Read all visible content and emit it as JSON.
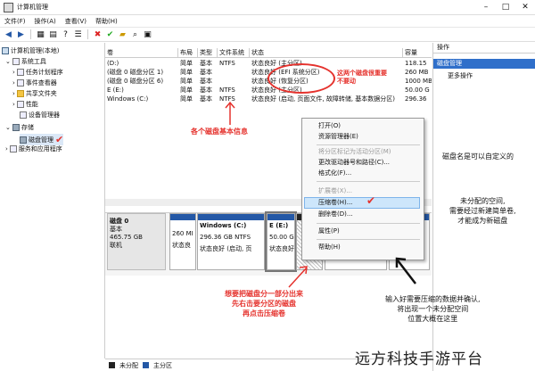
{
  "window": {
    "title": "计算机管理"
  },
  "menu": [
    "文件(F)",
    "操作(A)",
    "查看(V)",
    "帮助(H)"
  ],
  "tree": {
    "root": "计算机管理(本地)",
    "system_tools": "系统工具",
    "items": [
      "任务计划程序",
      "事件查看器",
      "共享文件夹",
      "性能",
      "设备管理器"
    ],
    "storage": "存储",
    "disk_mgmt": "磁盘管理",
    "services": "服务和应用程序"
  },
  "table": {
    "headers": [
      "卷",
      "布局",
      "类型",
      "文件系统",
      "状态",
      "容量"
    ],
    "rows": [
      [
        "(D:)",
        "简单",
        "基本",
        "NTFS",
        "状态良好 (主分区)",
        "118.15"
      ],
      [
        "(磁盘 0 磁盘分区 1)",
        "简单",
        "基本",
        "",
        "状态良好 (EFI 系统分区)",
        "260 MB"
      ],
      [
        "(磁盘 0 磁盘分区 6)",
        "简单",
        "基本",
        "",
        "状态良好 (恢复分区)",
        "1000 MB"
      ],
      [
        "E (E:)",
        "简单",
        "基本",
        "NTFS",
        "状态良好 (主分区)",
        "50.00 G"
      ],
      [
        "Windows (C:)",
        "简单",
        "基本",
        "NTFS",
        "状态良好 (启动, 页面文件, 故障转储, 基本数据分区)",
        "296.36"
      ]
    ]
  },
  "disk": {
    "label": "磁盘 0",
    "type": "基本",
    "size": "465.75 GB",
    "status": "联机",
    "segments": [
      {
        "l1": "260 MI",
        "l2": "状态良"
      },
      {
        "name": "Windows (C:)",
        "l1": "296.36 GB NTFS",
        "l2": "状态良好 (启动, 页"
      },
      {
        "name": "E (E:)",
        "l1": "50.00 G",
        "l2": "状态良好"
      },
      {
        "name": "",
        "l1": "",
        "l2": ""
      },
      {
        "name": "",
        "l1": "",
        "l2": ""
      },
      {
        "name": "",
        "l1": "",
        "l2": ""
      }
    ]
  },
  "legend": [
    "未分配",
    "主分区"
  ],
  "actions": {
    "header": "操作",
    "section": "磁盘管理",
    "more": "更多操作"
  },
  "context_menu": {
    "items": [
      {
        "label": "打开(O)",
        "disabled": false
      },
      {
        "label": "资源管理器(E)",
        "disabled": false
      },
      {
        "label": "将分区标记为活动分区(M)",
        "disabled": true
      },
      {
        "label": "更改驱动器号和路径(C)...",
        "disabled": false
      },
      {
        "label": "格式化(F)...",
        "disabled": false
      },
      {
        "label": "扩展卷(X)...",
        "disabled": true
      },
      {
        "label": "压缩卷(H)...",
        "disabled": false
      },
      {
        "label": "删除卷(D)...",
        "disabled": false
      },
      {
        "label": "属性(P)",
        "disabled": false
      },
      {
        "label": "帮助(H)",
        "disabled": false
      }
    ]
  },
  "annotations": {
    "oval_note": [
      "这两个磁盘很重要",
      "不要动"
    ],
    "info": "各个磁盘基本信息",
    "disk_name": "磁盘名是可以自定义的",
    "unallocated": [
      "未分配的空间,",
      "需要经过新建简单卷,",
      "才能成为新磁盘"
    ],
    "compress": [
      "想要把磁盘分一部分出来",
      "先右击要分区的磁盘",
      "再点击压缩卷"
    ],
    "input": [
      "输入好需要压缩的数据并确认,",
      "将出现一个未分配空间",
      "位置大概在这里"
    ]
  },
  "watermark": "远方科技手游平台",
  "colors": {
    "primary": "#2458a6",
    "annotation": "#e5322d",
    "highlight": "#2f6fca"
  }
}
